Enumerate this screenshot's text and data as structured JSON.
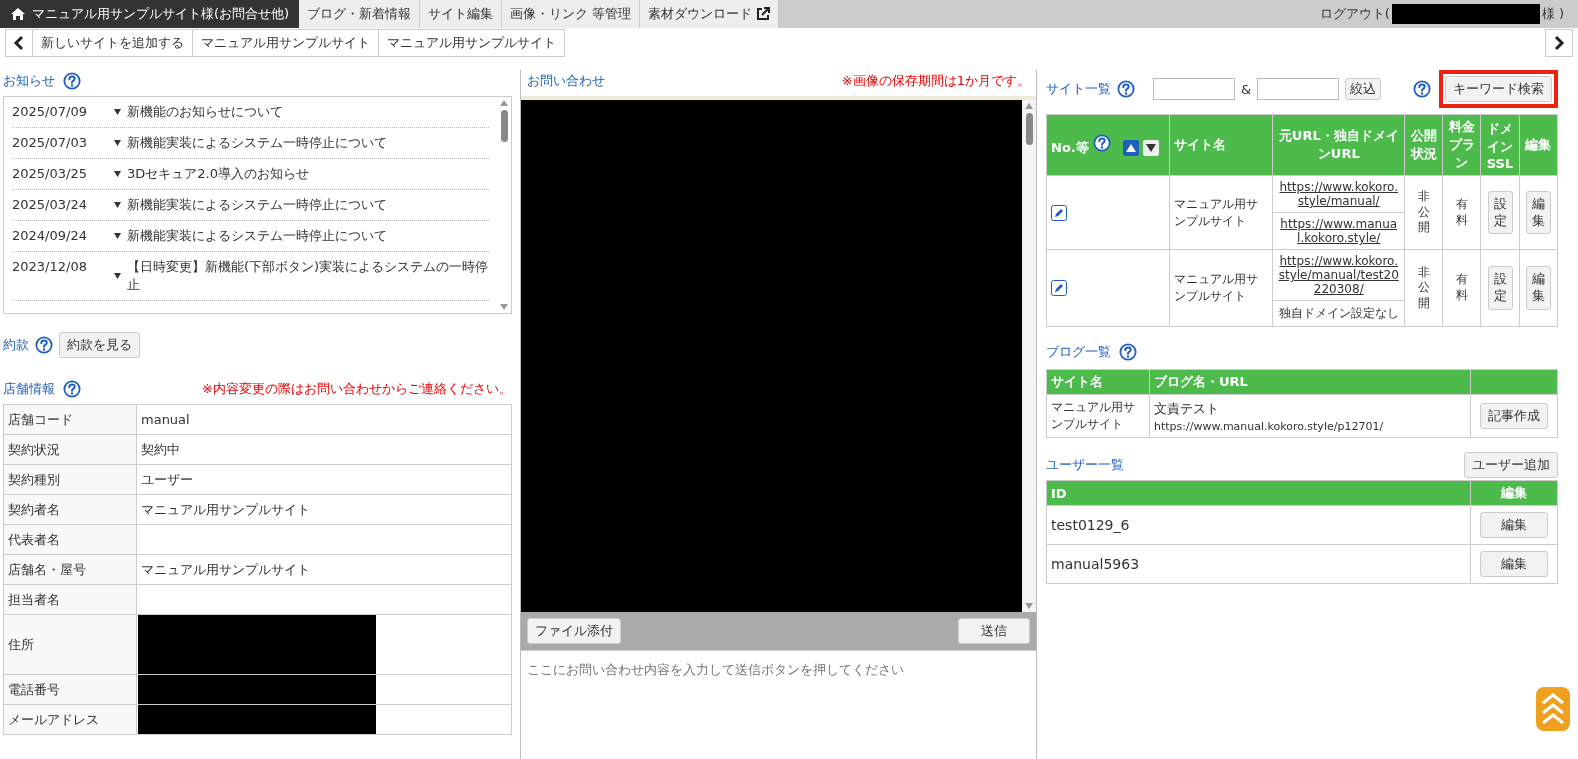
{
  "header": {
    "title": "マニュアル用サンプルサイト様(お問合せ他)",
    "tabs": [
      {
        "label": "ブログ・新着情報",
        "external": false
      },
      {
        "label": "サイト編集",
        "external": false
      },
      {
        "label": "画像・リンク 等管理",
        "external": false
      },
      {
        "label": "素材ダウンロード",
        "external": true
      }
    ],
    "logout_prefix": "ログアウト(",
    "logout_suffix": "様 )"
  },
  "site_tabs": [
    "新しいサイトを追加する",
    "マニュアル用サンプルサイト",
    "マニュアル用サンプルサイト"
  ],
  "notices": {
    "title": "お知らせ",
    "items": [
      {
        "date": "2025/07/09",
        "title": "新機能のお知らせについて"
      },
      {
        "date": "2025/07/03",
        "title": "新機能実装によるシステム一時停止について"
      },
      {
        "date": "2025/03/25",
        "title": "3Dセキュア2.0導入のお知らせ"
      },
      {
        "date": "2025/03/24",
        "title": "新機能実装によるシステム一時停止について"
      },
      {
        "date": "2024/09/24",
        "title": "新機能実装によるシステム一時停止について"
      },
      {
        "date": "2023/12/08",
        "title": "【日時変更】新機能(下部ボタン)実装によるシステムの一時停止"
      }
    ]
  },
  "terms": {
    "title": "約款",
    "button": "約款を見る"
  },
  "store_info": {
    "title": "店舗情報",
    "notice": "※内容変更の際はお問い合わせからご連絡ください。",
    "rows": [
      {
        "label": "店舗コード",
        "value": "manual",
        "redacted": false
      },
      {
        "label": "契約状況",
        "value": "契約中",
        "redacted": false
      },
      {
        "label": "契約種別",
        "value": "ユーザー",
        "redacted": false
      },
      {
        "label": "契約者名",
        "value": "マニュアル用サンプルサイト",
        "redacted": false
      },
      {
        "label": "代表者名",
        "redacted": false
      },
      {
        "label": "店舗名・屋号",
        "value": "マニュアル用サンプルサイト",
        "redacted": false
      },
      {
        "label": "担当者名",
        "redacted": false
      },
      {
        "label": "住所",
        "redacted": true
      },
      {
        "label": "電話番号",
        "redacted": true
      },
      {
        "label": "メールアドレス",
        "redacted": true
      }
    ]
  },
  "inquiry": {
    "title": "お問い合わせ",
    "notice": "※画像の保存期間は1か月です。",
    "attach_button": "ファイル添付",
    "send_button": "送信",
    "placeholder": "ここにお問い合わせ内容を入力して送信ボタンを押してください"
  },
  "sites": {
    "title": "サイト一覧",
    "joiner": "&",
    "filter_button": "絞込",
    "keyword_button": {
      "label": "キーワード検索",
      "highlighted": true
    },
    "sort": [
      {
        "kind": "ascending",
        "selected": true
      },
      {
        "kind": "descending",
        "selected": false
      }
    ],
    "columns": [
      "No.等",
      "サイト名",
      "元URL・独自ドメインURL",
      "公開状況",
      "料金プラン",
      "ドメイン SSL",
      "編集"
    ],
    "rows": [
      {
        "name": "マニュアル用サンプルサイト",
        "urls": [
          {
            "text": "https://www.kokoro.style/manual/",
            "link": true
          },
          {
            "text": "https://www.manual.kokoro.style/",
            "link": true
          }
        ],
        "status": "非公開",
        "plan": "有料",
        "ssl_button": "設定",
        "edit_button": "編集"
      },
      {
        "name": "マニュアル用サンプルサイト",
        "urls": [
          {
            "text": "https://www.kokoro.style/manual/test20220308/",
            "link": true
          },
          {
            "text": "独自ドメイン設定なし",
            "link": false
          }
        ],
        "status": "非公開",
        "plan": "有料",
        "ssl_button": "設定",
        "edit_button": "編集"
      }
    ]
  },
  "blogs": {
    "title": "ブログ一覧",
    "columns": [
      "サイト名",
      "ブログ名・URL"
    ],
    "rows": [
      {
        "site": "マニュアル用サンプルサイト",
        "blog": "文責テスト",
        "url": "https://www.manual.kokoro.style/p12701/",
        "button": "記事作成"
      }
    ]
  },
  "users": {
    "title": "ユーザー一覧",
    "add_button": "ユーザー追加",
    "columns": [
      "ID",
      "編集"
    ],
    "rows": [
      {
        "id": "test0129_6",
        "button": "編集"
      },
      {
        "id": "manual5963",
        "button": "編集"
      }
    ]
  }
}
